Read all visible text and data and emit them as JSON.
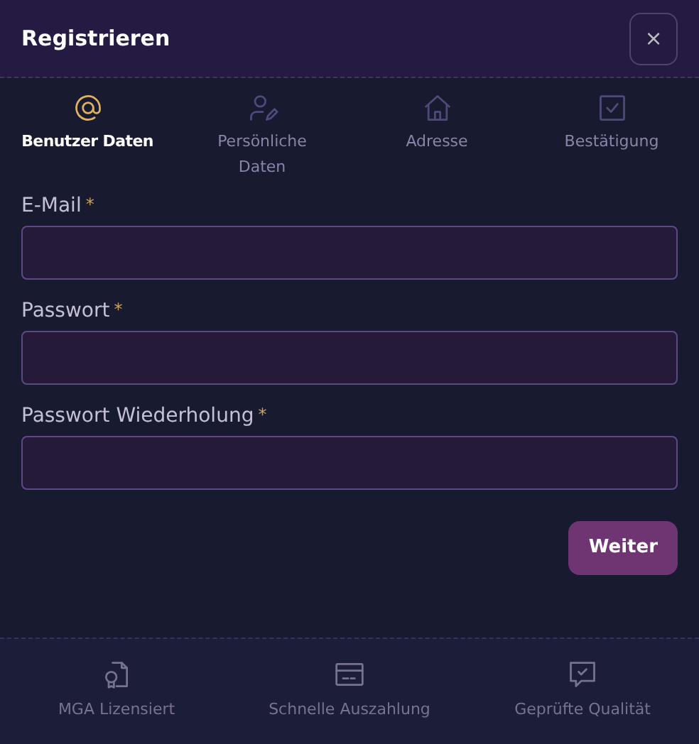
{
  "window": {
    "title": "Registrieren",
    "close": "×"
  },
  "steps": [
    {
      "label": "Benutzer Daten",
      "kind": "at",
      "selected": true
    },
    {
      "label": "Persönliche Daten",
      "kind": "user",
      "selected": false
    },
    {
      "label": "Adresse",
      "kind": "home",
      "selected": false
    },
    {
      "label": "Bestätigung",
      "kind": "check",
      "selected": false
    }
  ],
  "fields": [
    {
      "label": "E-Mail",
      "required_mark": "*"
    },
    {
      "label": "Passwort",
      "required_mark": "*"
    },
    {
      "label": "Passwort Wiederholung",
      "required_mark": "*"
    }
  ],
  "next_button": "Weiter",
  "features": [
    {
      "label": "MGA Lizensiert",
      "kind": "certificate"
    },
    {
      "label": "Schnelle Auszahlung",
      "kind": "card"
    },
    {
      "label": "Geprüfte Qualität",
      "kind": "chat-check"
    }
  ]
}
